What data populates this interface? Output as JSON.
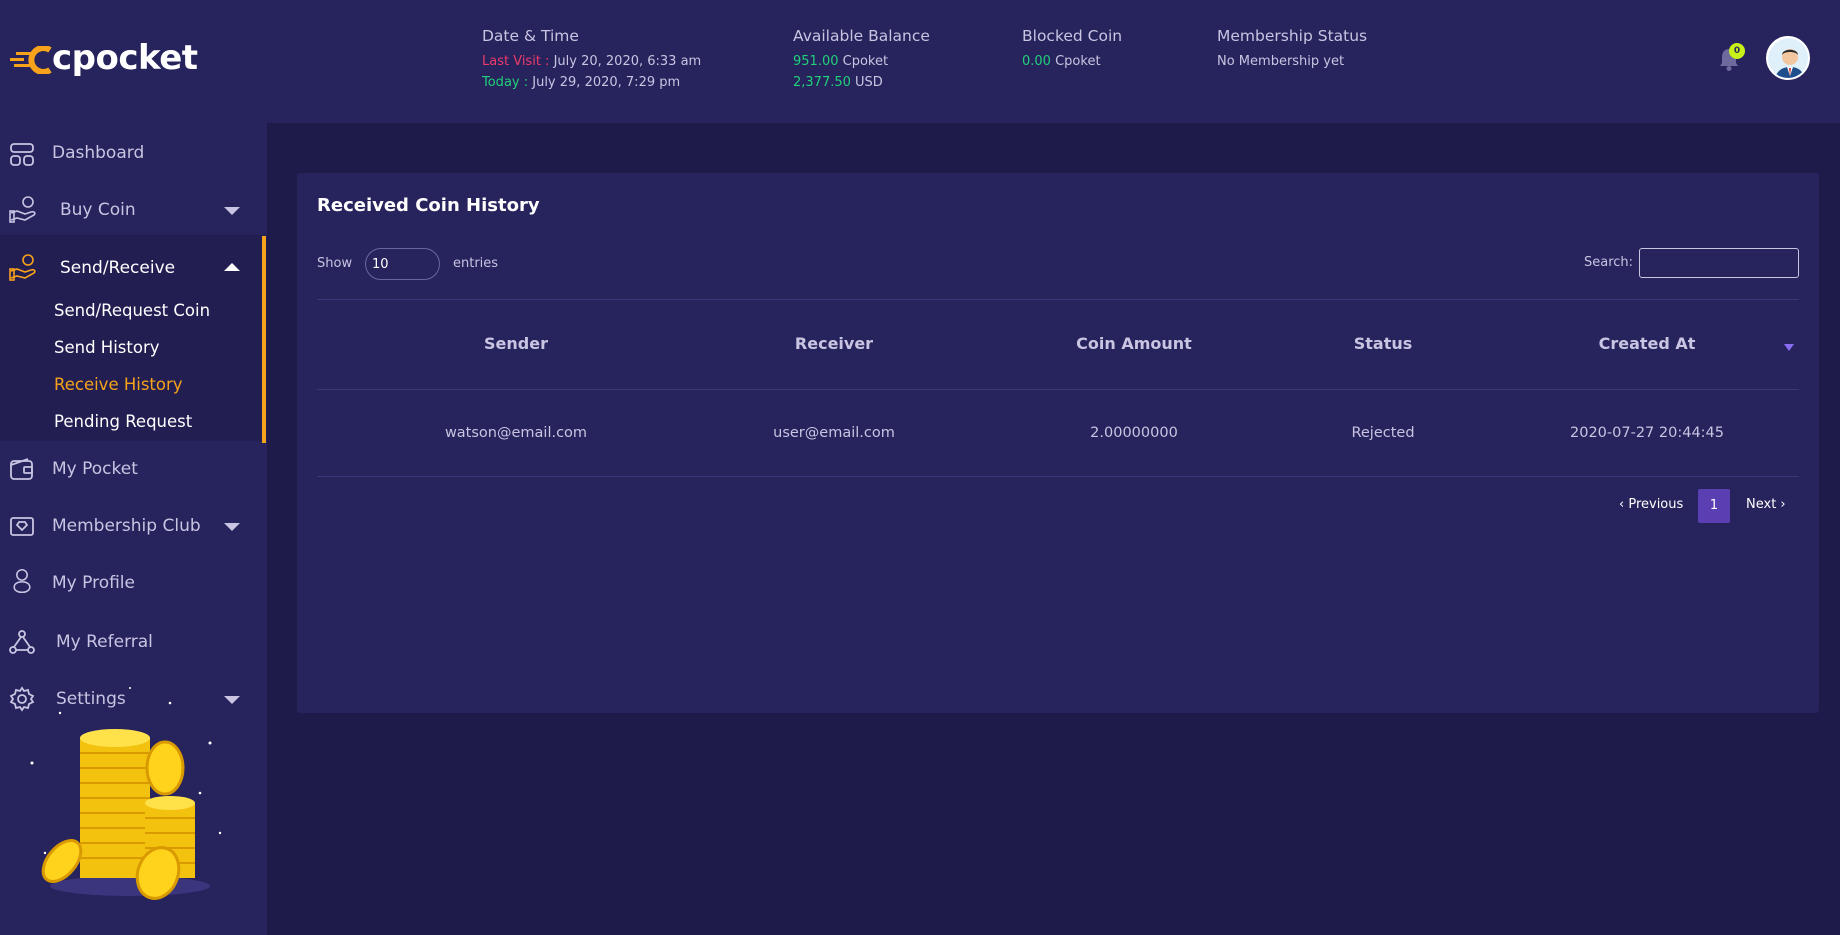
{
  "brand": {
    "name": "cpocket",
    "logo_color": "#f6a21a"
  },
  "header": {
    "datetime": {
      "title": "Date & Time",
      "last_visit_label": "Last Visit :",
      "last_visit_value": "July 20, 2020, 6:33 am",
      "today_label": "Today :",
      "today_value": "July 29, 2020, 7:29 pm"
    },
    "balance": {
      "title": "Available Balance",
      "cpoket_amount": "951.00",
      "cpoket_unit": "Cpoket",
      "usd_amount": "2,377.50",
      "usd_unit": "USD"
    },
    "blocked": {
      "title": "Blocked Coin",
      "amount": "0.00",
      "unit": "Cpoket"
    },
    "membership": {
      "title": "Membership Status",
      "value": "No Membership yet"
    },
    "notifications": {
      "count": "0",
      "icon": "bell-icon"
    },
    "avatar_icon": "user-avatar"
  },
  "sidebar": {
    "items": [
      {
        "label": "Dashboard",
        "icon": "dashboard-icon"
      },
      {
        "label": "Buy Coin",
        "icon": "hand-coin-icon"
      },
      {
        "label": "Send/Receive",
        "icon": "hand-coin-icon"
      },
      {
        "label": "My Pocket",
        "icon": "wallet-icon"
      },
      {
        "label": "Membership Club",
        "icon": "diamond-card-icon"
      },
      {
        "label": "My Profile",
        "icon": "user-icon"
      },
      {
        "label": "My Referral",
        "icon": "share-network-icon"
      },
      {
        "label": "Settings",
        "icon": "gear-icon"
      }
    ],
    "send_receive_sub": [
      {
        "label": "Send/Request Coin"
      },
      {
        "label": "Send History"
      },
      {
        "label": "Receive History"
      },
      {
        "label": "Pending Request"
      }
    ],
    "active_color": "#f6a21a"
  },
  "main": {
    "title": "Received Coin History",
    "show_label": "Show",
    "page_size": "10",
    "entries_label": "entries",
    "search_label": "Search:",
    "search_value": "",
    "columns": [
      "Sender",
      "Receiver",
      "Coin Amount",
      "Status",
      "Created At"
    ],
    "rows": [
      [
        "watson@email.com",
        "user@email.com",
        "2.00000000",
        "Rejected",
        "2020-07-27 20:44:45"
      ]
    ],
    "pagination": {
      "prev": "‹ Previous",
      "current": "1",
      "next": "Next ›"
    }
  }
}
